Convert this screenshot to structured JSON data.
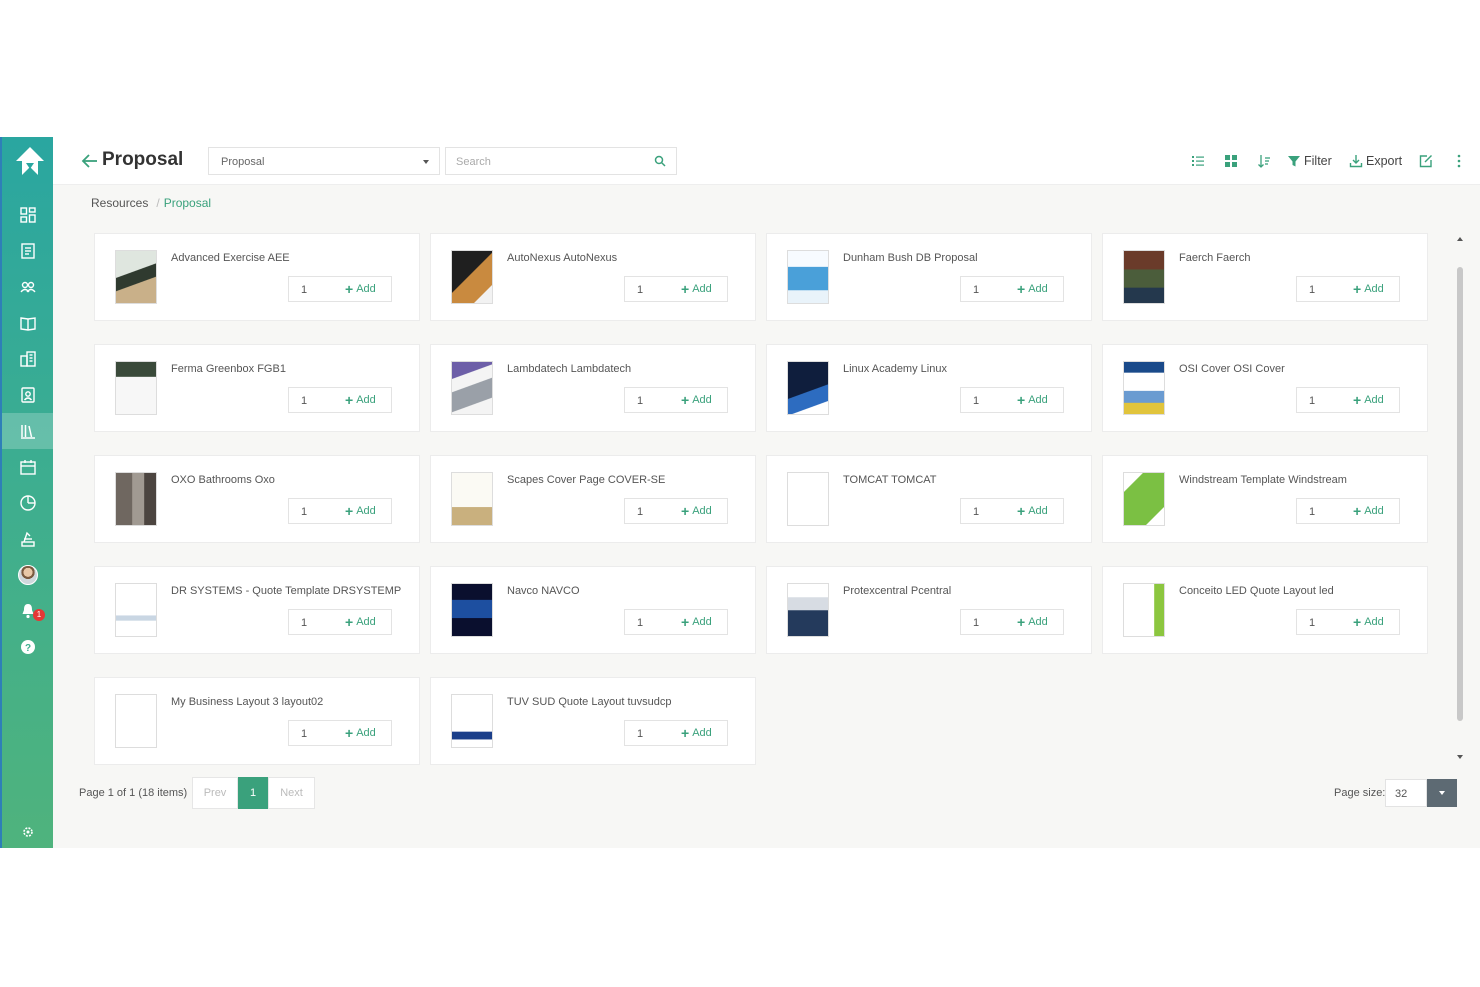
{
  "header": {
    "title": "Proposal",
    "type_select": "Proposal",
    "search_placeholder": "Search",
    "filter_label": "Filter",
    "export_label": "Export"
  },
  "breadcrumb": {
    "root": "Resources",
    "separator": "/",
    "current": "Proposal"
  },
  "sidebar": {
    "items": [
      "dashboard-icon",
      "document-icon",
      "contacts-icon",
      "catalog-icon",
      "reports-icon",
      "profile-icon",
      "library-icon",
      "calendar-icon",
      "chart-icon",
      "tasks-icon",
      "avatar",
      "notifications-icon",
      "help-icon"
    ],
    "notification_count": "1"
  },
  "cards": [
    {
      "title": "Advanced Exercise AEE",
      "qty": "1",
      "add": "Add"
    },
    {
      "title": "AutoNexus AutoNexus",
      "qty": "1",
      "add": "Add"
    },
    {
      "title": "Dunham Bush DB Proposal",
      "qty": "1",
      "add": "Add"
    },
    {
      "title": "Faerch Faerch",
      "qty": "1",
      "add": "Add"
    },
    {
      "title": "Ferma Greenbox FGB1",
      "qty": "1",
      "add": "Add"
    },
    {
      "title": "Lambdatech Lambdatech",
      "qty": "1",
      "add": "Add"
    },
    {
      "title": "Linux Academy Linux",
      "qty": "1",
      "add": "Add"
    },
    {
      "title": "OSI Cover OSI Cover",
      "qty": "1",
      "add": "Add"
    },
    {
      "title": "OXO Bathrooms Oxo",
      "qty": "1",
      "add": "Add"
    },
    {
      "title": "Scapes Cover Page COVER-SE",
      "qty": "1",
      "add": "Add"
    },
    {
      "title": "TOMCAT TOMCAT",
      "qty": "1",
      "add": "Add"
    },
    {
      "title": "Windstream Template Windstream",
      "qty": "1",
      "add": "Add"
    },
    {
      "title": "DR SYSTEMS - Quote Template DRSYSTEMP",
      "qty": "1",
      "add": "Add"
    },
    {
      "title": "Navco NAVCO",
      "qty": "1",
      "add": "Add"
    },
    {
      "title": "Protexcentral Pcentral",
      "qty": "1",
      "add": "Add"
    },
    {
      "title": "Conceito LED Quote Layout led",
      "qty": "1",
      "add": "Add"
    },
    {
      "title": "My Business Layout 3 layout02",
      "qty": "1",
      "add": "Add"
    },
    {
      "title": "TUV SUD Quote Layout tuvsudcp",
      "qty": "1",
      "add": "Add"
    }
  ],
  "pager": {
    "info": "Page 1 of 1 (18 items)",
    "prev": "Prev",
    "current": "1",
    "next": "Next",
    "page_size_label": "Page size:",
    "page_size": "32"
  },
  "colors": {
    "accent": "#3aa17c",
    "sidebar_top": "#2aa6a0",
    "sidebar_bottom": "#4fb37d"
  }
}
